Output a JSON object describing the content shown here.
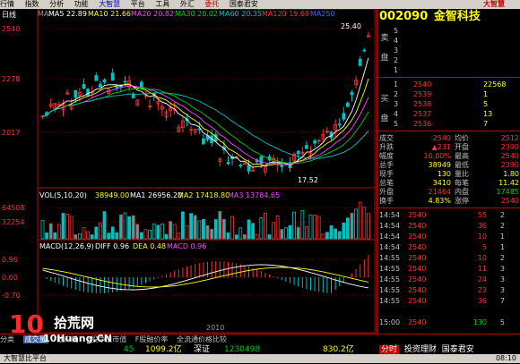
{
  "menu": {
    "items": [
      "行情",
      "指数",
      "分析",
      "功能",
      "大智慧",
      "平台",
      "工具",
      "外汇",
      "委托",
      "国泰君安"
    ],
    "brand": "大智慧"
  },
  "chart": {
    "title": "日线",
    "ma_legend": {
      "ma": "MA",
      "ma5": "MA5 22.89",
      "ma10": "MA10 21.66",
      "ma20": "MA20 20.82",
      "ma30": "MA30 20.02",
      "ma60": "MA60 20.35",
      "ma120": "MA120 19.68",
      "ma250": "MA250"
    },
    "price_labels": [
      "2540",
      "2278",
      "2017"
    ],
    "high_annot": "25.40",
    "low_annot": "17.52",
    "vol_legend": {
      "vol": "VOL(5,10,20)",
      "v1": "38949.00",
      "ma1": "MA1 26956.20",
      "ma2": "MA2 17418.80",
      "ma3": "MA3 13784.65"
    },
    "vol_labels": [
      "64508",
      "32254"
    ],
    "macd_legend": {
      "name": "MACD(12,26,9)",
      "diff": "DIFF 0.96",
      "dea": "DEA 0.48",
      "macd": "MACD 0.96"
    },
    "macd_labels": [
      "0.96",
      "0.00",
      "-0.70"
    ],
    "year": "2010"
  },
  "stock": {
    "code": "002090",
    "name": "金智科技"
  },
  "orderbook": {
    "sell_label": "卖\n盘",
    "buy_label": "买\n盘",
    "sell": [
      {
        "lvl": "5",
        "price": "",
        "vol": ""
      },
      {
        "lvl": "4",
        "price": "",
        "vol": ""
      },
      {
        "lvl": "3",
        "price": "",
        "vol": ""
      },
      {
        "lvl": "2",
        "price": "",
        "vol": ""
      },
      {
        "lvl": "1",
        "price": "",
        "vol": ""
      }
    ],
    "buy": [
      {
        "lvl": "1",
        "price": "2540",
        "vol": "22568"
      },
      {
        "lvl": "2",
        "price": "2539",
        "vol": "1"
      },
      {
        "lvl": "3",
        "price": "2538",
        "vol": "5"
      },
      {
        "lvl": "4",
        "price": "2537",
        "vol": "13"
      },
      {
        "lvl": "5",
        "price": "2536",
        "vol": "7"
      }
    ]
  },
  "stats": [
    {
      "k1": "成交",
      "v1": "2540",
      "k2": "均价",
      "v2": "2512"
    },
    {
      "k1": "升跌",
      "v1": "▲231",
      "k2": "开盘",
      "v2": "2390"
    },
    {
      "k1": "幅度",
      "v1": "10.00%",
      "k2": "最高",
      "v2": "2540"
    },
    {
      "k1": "总手",
      "v1": "38949",
      "k2": "最低",
      "v2": "2390"
    },
    {
      "k1": "现手",
      "v1": "130",
      "k2": "量比",
      "v2": "1.80"
    },
    {
      "k1": "总笔",
      "v1": "3410",
      "k2": "每笔",
      "v2": "11.42"
    },
    {
      "k1": "外盘",
      "v1": "21464",
      "k2": "内盘",
      "v2": "17485"
    },
    {
      "k1": "换手",
      "v1": "4.83%",
      "k2": "涨停",
      "v2": "2540"
    }
  ],
  "trades": [
    {
      "t": "14:54",
      "p": "2540",
      "v": "55",
      "n": "2",
      "m": ""
    },
    {
      "t": "14:54",
      "p": "2540",
      "v": "36",
      "n": "2",
      "m": ""
    },
    {
      "t": "14:54",
      "p": "2540",
      "v": "10",
      "n": "1",
      "m": ""
    },
    {
      "t": "14:54",
      "p": "2540",
      "v": "5",
      "n": "1",
      "m": ""
    },
    {
      "t": "14:55",
      "p": "2540",
      "v": "10",
      "n": "2",
      "m": ""
    },
    {
      "t": "14:55",
      "p": "2540",
      "v": "11",
      "n": "3",
      "m": ""
    },
    {
      "t": "14:55",
      "p": "2540",
      "v": "24",
      "n": "3",
      "m": ""
    },
    {
      "t": "14:55",
      "p": "2540",
      "v": "23",
      "n": "3",
      "m": ""
    },
    {
      "t": "14:55",
      "p": "2540",
      "v": "36",
      "n": "7",
      "m": ""
    },
    {
      "t": "15:00",
      "p": "2540",
      "v": "130",
      "n": "5",
      "m": ""
    }
  ],
  "bottom_tabs": [
    "分类",
    "成交量",
    "散户线",
    "F股净值市值",
    "F股融价率",
    "全流通价格比较"
  ],
  "ticker": {
    "idx1": "45",
    "val1": "1099.2亿",
    "name2": "深证",
    "val2": "1230498",
    "val3": "830.2亿"
  },
  "right_tabs": [
    "分时",
    "投资理财",
    "国泰君安"
  ],
  "watermark": {
    "num": "10",
    "cn": "拾荒网",
    "url": "10Huang.CN"
  },
  "status": {
    "left": "大智慧比平台",
    "time": "08:10"
  }
}
